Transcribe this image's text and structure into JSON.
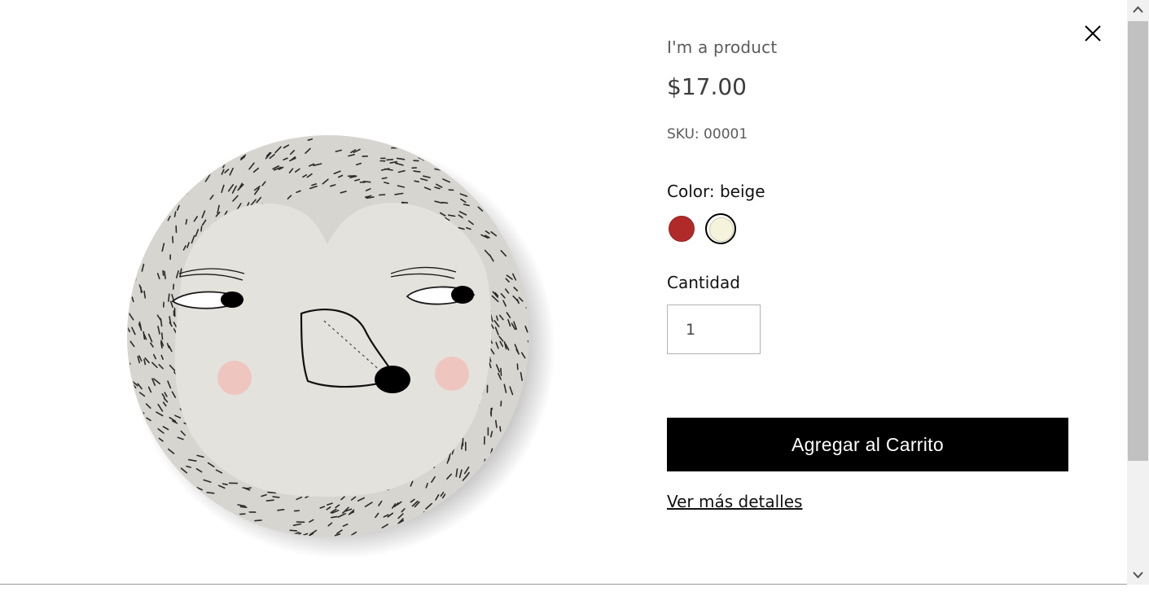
{
  "product": {
    "title": "I'm a product",
    "price": "$17.00",
    "sku": "SKU: 00001",
    "image_icon": "plate-face-image"
  },
  "color": {
    "label": "Color: beige",
    "options": [
      {
        "name": "red",
        "hex": "#b12a2a",
        "selected": false
      },
      {
        "name": "beige",
        "hex": "#f6f3dc",
        "selected": true
      }
    ]
  },
  "quantity": {
    "label": "Cantidad",
    "value": "1"
  },
  "actions": {
    "add_to_cart": "Agregar al Carrito",
    "more_details": "Ver más detalles"
  },
  "icons": {
    "close": "close-icon",
    "scroll_up": "chevron-up-icon",
    "scroll_down": "chevron-down-icon"
  },
  "colors": {
    "button_bg": "#000000",
    "button_text": "#ffffff"
  }
}
